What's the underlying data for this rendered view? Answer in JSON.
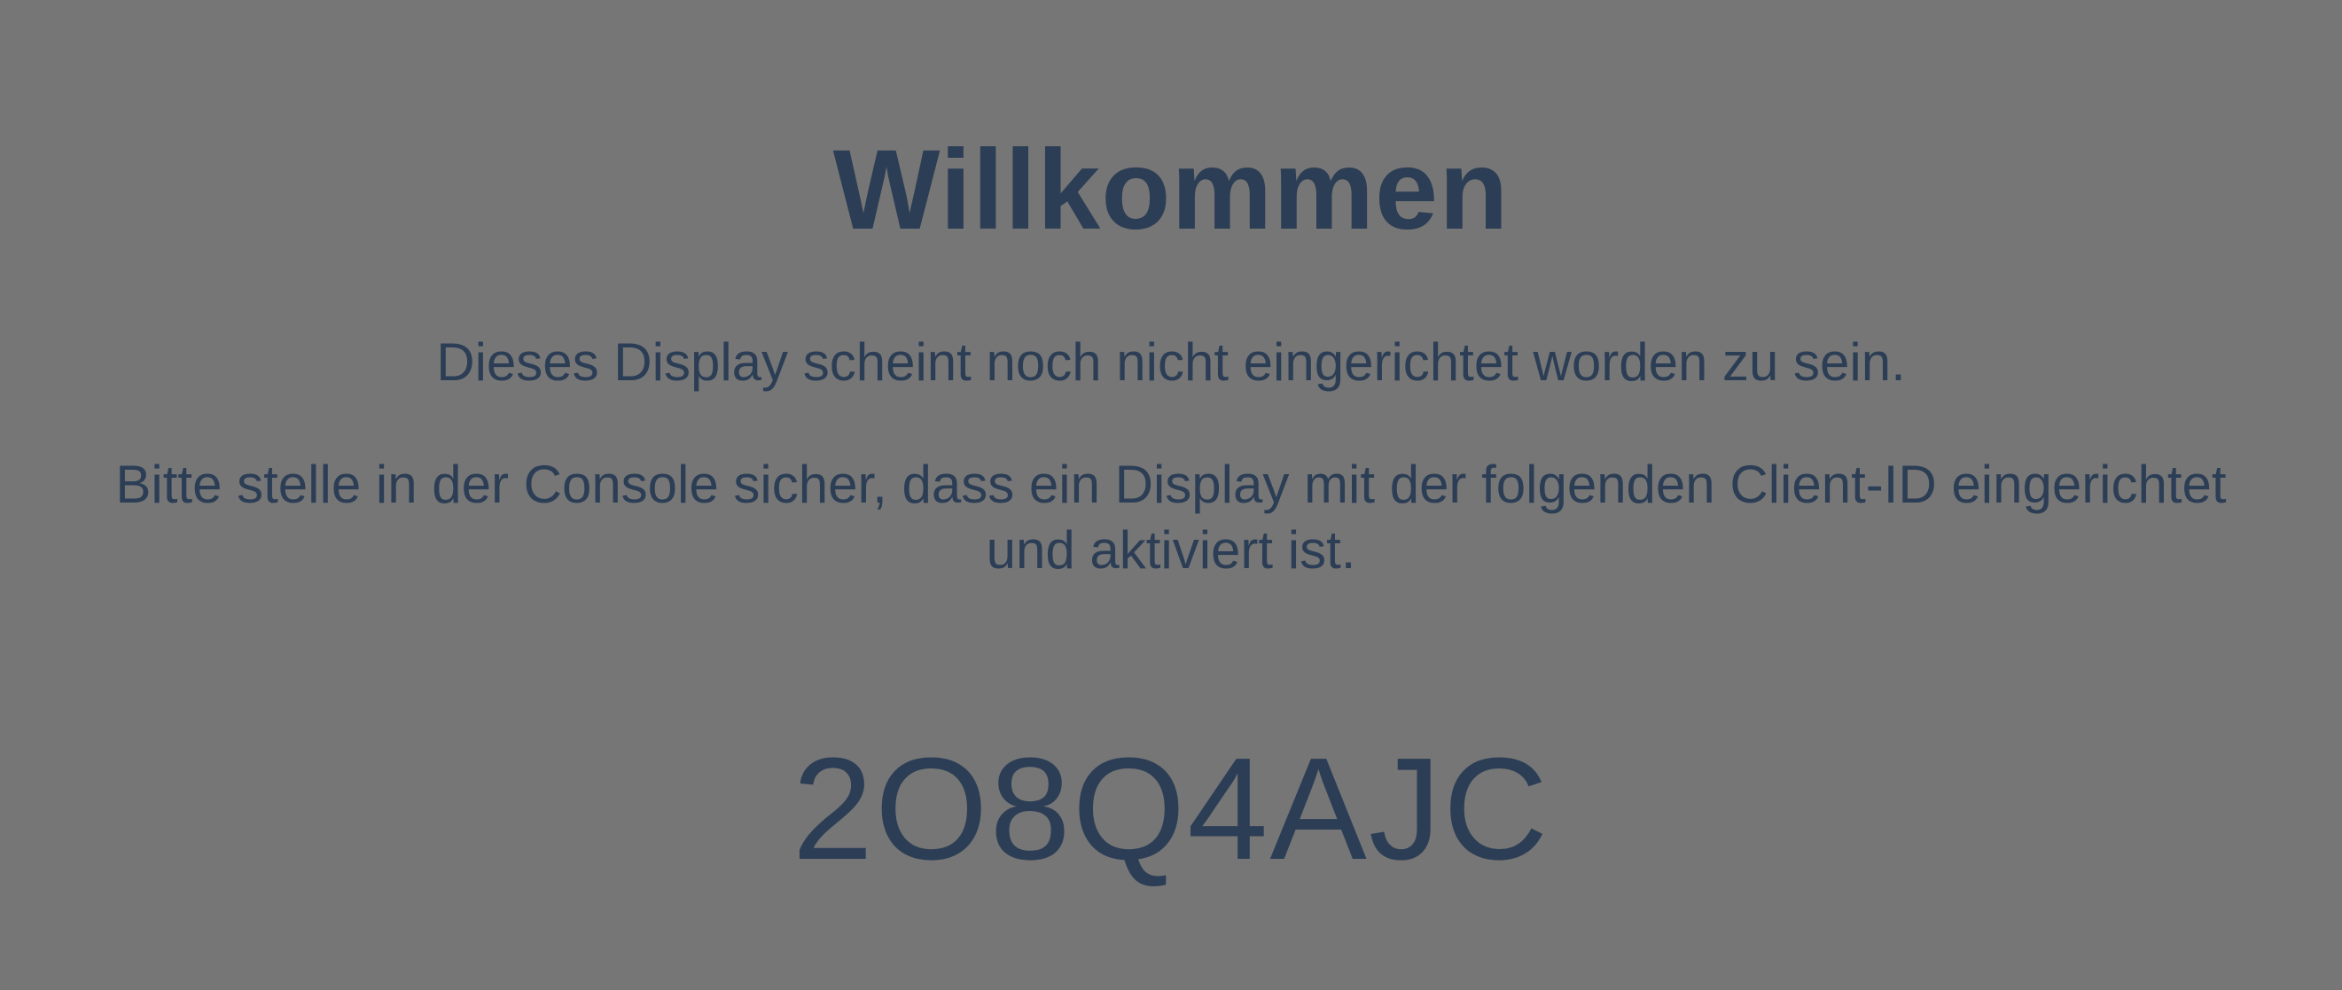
{
  "welcome": {
    "title": "Willkommen",
    "message_not_set_up": "Dieses Display scheint noch nicht eingerichtet worden zu sein.",
    "message_instructions": "Bitte stelle in der Console sicher, dass ein Display mit der folgenden Client-ID eingerichtet und aktiviert ist.",
    "client_id": "2O8Q4AJC"
  },
  "colors": {
    "background": "#767676",
    "text": "#2c3e55"
  }
}
